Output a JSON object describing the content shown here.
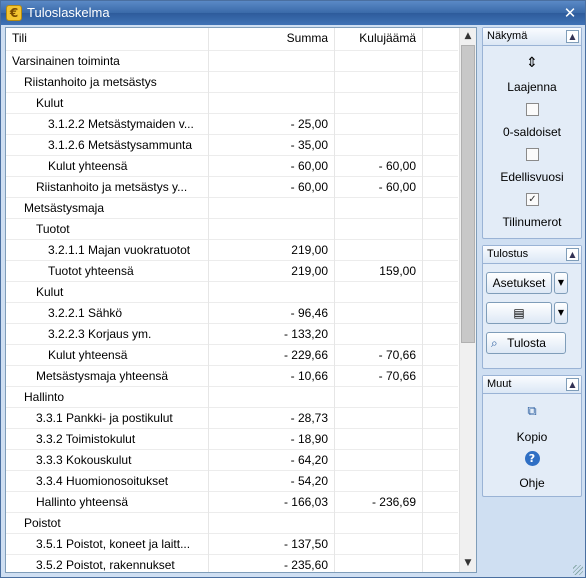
{
  "window": {
    "title": "Tuloslaskelma",
    "app_icon": "euro-icon",
    "close": "✕"
  },
  "table": {
    "columns": [
      "Tili",
      "Summa",
      "Kulujäämä"
    ],
    "rows": [
      {
        "name": "Varsinainen toiminta",
        "indent": 0,
        "sum": "",
        "bal": ""
      },
      {
        "name": "Riistanhoito ja metsästys",
        "indent": 1,
        "sum": "",
        "bal": ""
      },
      {
        "name": "Kulut",
        "indent": 2,
        "sum": "",
        "bal": ""
      },
      {
        "name": "3.1.2.2 Metsästymaiden v...",
        "indent": 3,
        "sum": "- 25,00",
        "bal": ""
      },
      {
        "name": "3.1.2.6 Metsästysammunta",
        "indent": 3,
        "sum": "- 35,00",
        "bal": ""
      },
      {
        "name": "Kulut yhteensä",
        "indent": 3,
        "sum": "- 60,00",
        "bal": "- 60,00"
      },
      {
        "name": "Riistanhoito ja metsästys y...",
        "indent": 2,
        "sum": "- 60,00",
        "bal": "- 60,00"
      },
      {
        "name": "Metsästysmaja",
        "indent": 1,
        "sum": "",
        "bal": ""
      },
      {
        "name": "Tuotot",
        "indent": 2,
        "sum": "",
        "bal": ""
      },
      {
        "name": "3.2.1.1 Majan vuokratuotot",
        "indent": 3,
        "sum": "219,00",
        "bal": ""
      },
      {
        "name": "Tuotot yhteensä",
        "indent": 3,
        "sum": "219,00",
        "bal": "159,00"
      },
      {
        "name": "Kulut",
        "indent": 2,
        "sum": "",
        "bal": ""
      },
      {
        "name": "3.2.2.1 Sähkö",
        "indent": 3,
        "sum": "- 96,46",
        "bal": ""
      },
      {
        "name": "3.2.2.3 Korjaus ym.",
        "indent": 3,
        "sum": "- 133,20",
        "bal": ""
      },
      {
        "name": "Kulut yhteensä",
        "indent": 3,
        "sum": "- 229,66",
        "bal": "- 70,66"
      },
      {
        "name": "Metsästysmaja yhteensä",
        "indent": 2,
        "sum": "- 10,66",
        "bal": "- 70,66"
      },
      {
        "name": "Hallinto",
        "indent": 1,
        "sum": "",
        "bal": ""
      },
      {
        "name": "3.3.1 Pankki- ja postikulut",
        "indent": 2,
        "sum": "- 28,73",
        "bal": ""
      },
      {
        "name": "3.3.2 Toimistokulut",
        "indent": 2,
        "sum": "- 18,90",
        "bal": ""
      },
      {
        "name": "3.3.3 Kokouskulut",
        "indent": 2,
        "sum": "- 64,20",
        "bal": ""
      },
      {
        "name": "3.3.4 Huomionosoitukset",
        "indent": 2,
        "sum": "- 54,20",
        "bal": ""
      },
      {
        "name": "Hallinto yhteensä",
        "indent": 2,
        "sum": "- 166,03",
        "bal": "- 236,69"
      },
      {
        "name": "Poistot",
        "indent": 1,
        "sum": "",
        "bal": ""
      },
      {
        "name": "3.5.1 Poistot, koneet ja laitt...",
        "indent": 2,
        "sum": "- 137,50",
        "bal": ""
      },
      {
        "name": "3.5.2 Poistot, rakennukset",
        "indent": 2,
        "sum": "- 235,60",
        "bal": ""
      }
    ]
  },
  "panels": {
    "nakyma": {
      "title": "Näkymä",
      "expand_label": "Laajenna",
      "zero_balances_label": "0-saldoiset",
      "zero_balances_checked": false,
      "prev_year_label": "Edellisvuosi",
      "prev_year_checked": false,
      "account_numbers_label": "Tilinumerot",
      "account_numbers_checked": true,
      "check_mark": "✓"
    },
    "tulostus": {
      "title": "Tulostus",
      "settings_label": "Asetukset",
      "print_label": "Tulosta",
      "document_icon": "document-icon"
    },
    "muut": {
      "title": "Muut",
      "copy_label": "Kopio",
      "help_label": "Ohje"
    }
  },
  "colors": {
    "title_bar": "#3a6aa9",
    "panel_bg": "#e3ecf7",
    "accent_border": "#7f9db9"
  }
}
